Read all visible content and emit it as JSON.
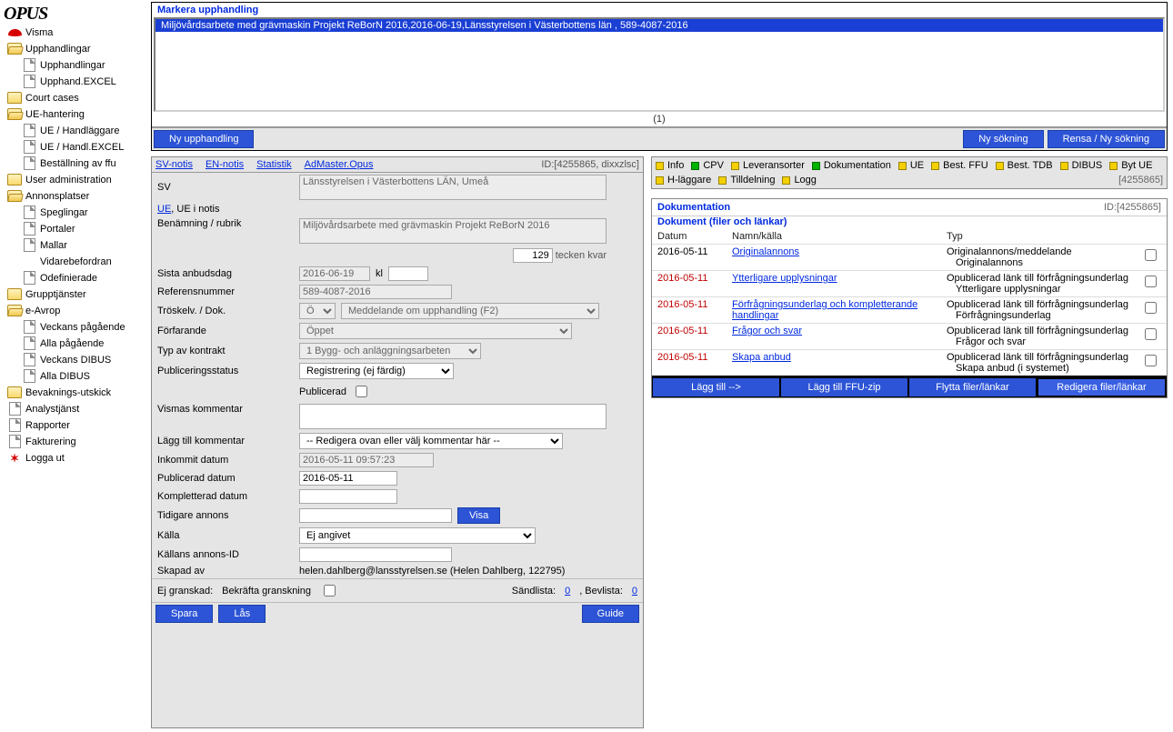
{
  "app_title": "OPUS",
  "sidebar": [
    {
      "depth": 1,
      "icon": "visma",
      "label": "Visma"
    },
    {
      "depth": 1,
      "icon": "folder-open",
      "label": "Upphandlingar"
    },
    {
      "depth": 2,
      "icon": "page",
      "label": "Upphandlingar"
    },
    {
      "depth": 2,
      "icon": "page",
      "label": "Upphand.EXCEL"
    },
    {
      "depth": 1,
      "icon": "folder",
      "label": "Court cases"
    },
    {
      "depth": 1,
      "icon": "folder-open",
      "label": "UE-hantering"
    },
    {
      "depth": 2,
      "icon": "page",
      "label": "UE / Handläggare"
    },
    {
      "depth": 2,
      "icon": "page",
      "label": "UE / Handl.EXCEL"
    },
    {
      "depth": 2,
      "icon": "page",
      "label": "Beställning av ffu"
    },
    {
      "depth": 1,
      "icon": "folder",
      "label": "User administration"
    },
    {
      "depth": 1,
      "icon": "folder-open",
      "label": "Annonsplatser"
    },
    {
      "depth": 2,
      "icon": "page",
      "label": "Speglingar"
    },
    {
      "depth": 2,
      "icon": "page",
      "label": "Portaler"
    },
    {
      "depth": 2,
      "icon": "page",
      "label": "Mallar"
    },
    {
      "depth": 2,
      "icon": "",
      "label": "Vidarebefordran"
    },
    {
      "depth": 2,
      "icon": "page",
      "label": "Odefinierade"
    },
    {
      "depth": 1,
      "icon": "folder",
      "label": "Grupptjänster"
    },
    {
      "depth": 1,
      "icon": "folder-open",
      "label": "e-Avrop"
    },
    {
      "depth": 2,
      "icon": "page",
      "label": "Veckans pågående"
    },
    {
      "depth": 2,
      "icon": "page",
      "label": "Alla pågående"
    },
    {
      "depth": 2,
      "icon": "page",
      "label": "Veckans DIBUS"
    },
    {
      "depth": 2,
      "icon": "page",
      "label": "Alla DIBUS"
    },
    {
      "depth": 1,
      "icon": "folder",
      "label": "Bevaknings-utskick"
    },
    {
      "depth": 1,
      "icon": "page",
      "label": "Analystjänst"
    },
    {
      "depth": 1,
      "icon": "page",
      "label": "Rapporter"
    },
    {
      "depth": 1,
      "icon": "page",
      "label": "Fakturering"
    },
    {
      "depth": 1,
      "icon": "logout",
      "label": "Logga ut"
    }
  ],
  "top_panel": {
    "title": "Markera upphandling",
    "item": "Miljövårdsarbete med grävmaskin Projekt ReBorN 2016,2016-06-19,Länsstyrelsen i Västerbottens län , 589-4087-2016",
    "count": "(1)",
    "btn_new": "Ny upphandling",
    "btn_search": "Ny sökning",
    "btn_clear": "Rensa / Ny sökning"
  },
  "tabs": {
    "sv": "SV-notis",
    "en": "EN-notis",
    "stat": "Statistik",
    "admaster": "AdMaster.Opus",
    "id_label": "ID:[4255865, dixxzlsc]"
  },
  "form": {
    "sv_label": "SV",
    "sv_value": "Länsstyrelsen i Västerbottens LÄN, Umeå",
    "ue_link": "UE",
    "ue_rest": ", UE i notis",
    "ben_label": "Benämning / rubrik",
    "ben_value": "Miljövårdsarbete med grävmaskin Projekt ReBorN 2016",
    "charcount": "129",
    "char_label": "tecken kvar",
    "sista_label": "Sista anbudsdag",
    "sista_value": "2016-06-19",
    "kl_label": "kl",
    "ref_label": "Referensnummer",
    "ref_value": "589-4087-2016",
    "trosk_label": "Tröskelv. / Dok.",
    "trosk_sel": "Ö",
    "trosk_msg": "Meddelande om upphandling (F2)",
    "forfar_label": "Förfarande",
    "forfar_value": "Öppet",
    "typ_label": "Typ av kontrakt",
    "typ_value": "1 Bygg- och anläggningsarbeten",
    "pub_label": "Publiceringsstatus",
    "pub_value": "Registrering (ej färdig)",
    "pubcb_label": "Publicerad",
    "kom_label": "Vismas kommentar",
    "addkom_label": "Lägg till kommentar",
    "addkom_value": "-- Redigera ovan eller välj kommentar här --",
    "ink_label": "Inkommit datum",
    "ink_value": "2016-05-11 09:57:23",
    "pubd_label": "Publicerad datum",
    "pubd_value": "2016-05-11",
    "kompl_label": "Kompletterad datum",
    "tid_label": "Tidigare annons",
    "visa_btn": "Visa",
    "kalla_label": "Källa",
    "kalla_value": "Ej angivet",
    "kalla_id_label": "Källans annons-ID",
    "skapad_label": "Skapad av",
    "skapad_value": "helen.dahlberg@lansstyrelsen.se (Helen Dahlberg, 122795)",
    "ejgr_label": "Ej granskad:",
    "bekr_label": "Bekräfta granskning",
    "sand_label": "Sändlista:",
    "sand_val": "0",
    "bev_label": ", Bevlista:",
    "bev_val": "0",
    "btn_spara": "Spara",
    "btn_las": "Lås",
    "btn_guide": "Guide"
  },
  "chips": [
    {
      "color": "y",
      "label": "Info"
    },
    {
      "color": "g",
      "label": "CPV"
    },
    {
      "color": "y",
      "label": "Leveransorter"
    },
    {
      "color": "g",
      "label": "Dokumentation"
    },
    {
      "color": "y",
      "label": "UE"
    },
    {
      "color": "y",
      "label": "Best. FFU"
    },
    {
      "color": "y",
      "label": "Best. TDB"
    },
    {
      "color": "y",
      "label": "DIBUS"
    },
    {
      "color": "y",
      "label": "Byt UE"
    },
    {
      "color": "y",
      "label": "H-läggare"
    },
    {
      "color": "y",
      "label": "Tilldelning"
    },
    {
      "color": "y",
      "label": "Logg"
    }
  ],
  "chip_id": "[4255865]",
  "doc_section": {
    "title1": "Dokumentation",
    "id": "ID:[4255865]",
    "title2": "Dokument (filer och länkar)",
    "head_datum": "Datum",
    "head_namn": "Namn/källa",
    "head_typ": "Typ",
    "rows": [
      {
        "date": "2016-05-11",
        "date_red": false,
        "name": "Originalannons",
        "t1": "Originalannons/meddelande",
        "t2": "Originalannons"
      },
      {
        "date": "2016-05-11",
        "date_red": true,
        "name": "Ytterligare upplysningar",
        "t1": "Opublicerad länk till förfrågningsunderlag",
        "t2": "Ytterligare upplysningar"
      },
      {
        "date": "2016-05-11",
        "date_red": true,
        "name": "Förfrågningsunderlag och kompletterande handlingar",
        "t1": "Opublicerad länk till förfrågningsunderlag",
        "t2": "Förfrågningsunderlag"
      },
      {
        "date": "2016-05-11",
        "date_red": true,
        "name": "Frågor och svar",
        "t1": "Opublicerad länk till förfrågningsunderlag",
        "t2": "Frågor och svar"
      },
      {
        "date": "2016-05-11",
        "date_red": true,
        "name": "Skapa anbud",
        "t1": "Opublicerad länk till förfrågningsunderlag",
        "t2": "Skapa anbud (i systemet)"
      }
    ],
    "btn_add": "Lägg till -->",
    "btn_zip": "Lägg till FFU-zip",
    "btn_move": "Flytta filer/länkar",
    "btn_edit": "Redigera filer/länkar"
  }
}
